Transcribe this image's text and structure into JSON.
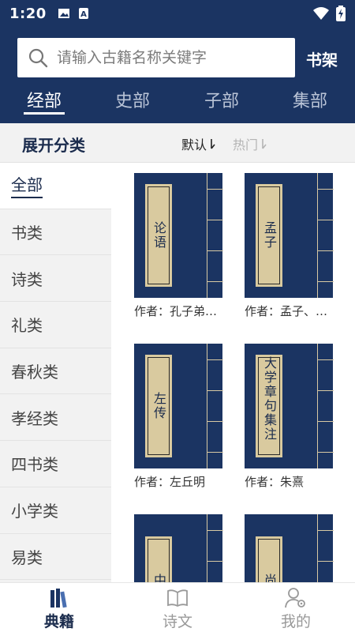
{
  "status": {
    "time": "1:20"
  },
  "search": {
    "placeholder": "请输入古籍名称关键字",
    "value": ""
  },
  "header": {
    "shelf_label": "书架"
  },
  "tabs": [
    {
      "label": "经部",
      "active": true
    },
    {
      "label": "史部",
      "active": false
    },
    {
      "label": "子部",
      "active": false
    },
    {
      "label": "集部",
      "active": false
    }
  ],
  "subbar": {
    "expand_label": "展开分类",
    "sort_default": "默认",
    "sort_hot": "热门"
  },
  "categories": [
    "全部",
    "书类",
    "诗类",
    "礼类",
    "春秋类",
    "孝经类",
    "四书类",
    "小学类",
    "易类"
  ],
  "books": [
    {
      "title": "论语",
      "author": "作者：孔子弟…"
    },
    {
      "title": "孟子",
      "author": "作者：孟子、…"
    },
    {
      "title": "左传",
      "author": "作者：左丘明"
    },
    {
      "title": "大学章句集注",
      "author": "作者：朱熹"
    },
    {
      "title": "中庸",
      "author": ""
    },
    {
      "title": "尚书",
      "author": ""
    }
  ],
  "nav": [
    {
      "label": "典籍",
      "icon": "books-icon",
      "active": true
    },
    {
      "label": "诗文",
      "icon": "open-book-icon",
      "active": false
    },
    {
      "label": "我的",
      "icon": "user-settings-icon",
      "active": false
    }
  ],
  "colors": {
    "primary": "#1b3462",
    "cover_label": "#d9ca9f",
    "background_gray": "#f2f2f2"
  }
}
